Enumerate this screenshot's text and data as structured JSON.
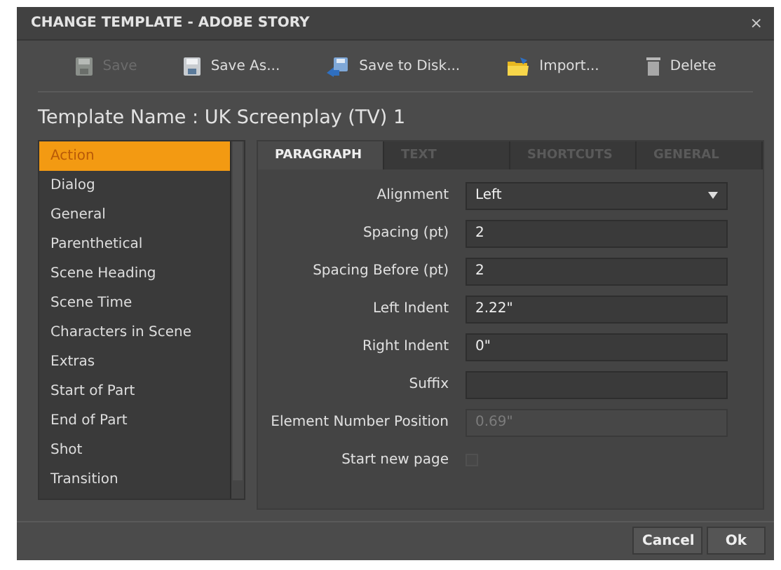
{
  "window": {
    "title": "CHANGE TEMPLATE - ADOBE STORY",
    "close": "×"
  },
  "toolbar": [
    {
      "kind": "save",
      "label": "Save",
      "disabled": true
    },
    {
      "kind": "save_as",
      "label": "Save As...",
      "disabled": false
    },
    {
      "kind": "save_disk",
      "label": "Save to Disk...",
      "disabled": false
    },
    {
      "kind": "import",
      "label": "Import...",
      "disabled": false
    },
    {
      "kind": "delete",
      "label": "Delete",
      "disabled": false
    }
  ],
  "template_name": "Template Name : UK Screenplay (TV) 1",
  "elements": [
    {
      "label": "Action",
      "selected": true
    },
    {
      "label": "Dialog",
      "selected": false
    },
    {
      "label": "General",
      "selected": false
    },
    {
      "label": "Parenthetical",
      "selected": false
    },
    {
      "label": "Scene Heading",
      "selected": false
    },
    {
      "label": "Scene Time",
      "selected": false
    },
    {
      "label": "Characters in Scene",
      "selected": false
    },
    {
      "label": "Extras",
      "selected": false
    },
    {
      "label": "Start of Part",
      "selected": false
    },
    {
      "label": "End of Part",
      "selected": false
    },
    {
      "label": "Shot",
      "selected": false
    },
    {
      "label": "Transition",
      "selected": false
    }
  ],
  "tabs": [
    {
      "label": "PARAGRAPH",
      "selected": true
    },
    {
      "label": "TEXT",
      "selected": false
    },
    {
      "label": "SHORTCUTS",
      "selected": false
    },
    {
      "label": "GENERAL",
      "selected": false
    }
  ],
  "fields": [
    {
      "kind": "dropdown",
      "label": "Alignment",
      "value": "Left",
      "disabled": false
    },
    {
      "kind": "text",
      "label": "Spacing (pt)",
      "value": "2",
      "disabled": false
    },
    {
      "kind": "text",
      "label": "Spacing Before (pt)",
      "value": "2",
      "disabled": false
    },
    {
      "kind": "text",
      "label": "Left Indent",
      "value": "2.22\"",
      "disabled": false
    },
    {
      "kind": "text",
      "label": "Right Indent",
      "value": "0\"",
      "disabled": false
    },
    {
      "kind": "text",
      "label": "Suffix",
      "disabled": false
    },
    {
      "kind": "text",
      "label": "Element Number Position",
      "value": "0.69\"",
      "disabled": true
    },
    {
      "kind": "checkbox",
      "label": "Start new page",
      "checked": false,
      "disabled": true
    }
  ],
  "buttons": [
    {
      "label": "Cancel"
    },
    {
      "label": "Ok"
    }
  ]
}
